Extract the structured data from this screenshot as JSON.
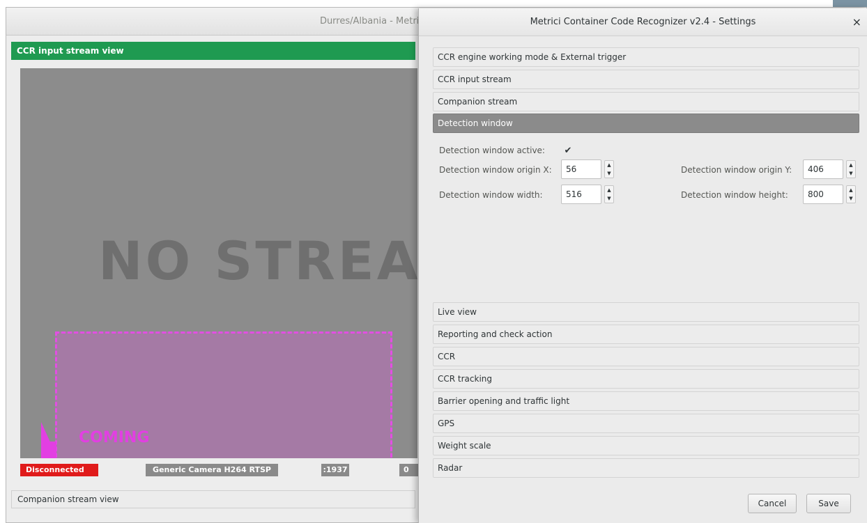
{
  "main_window": {
    "title": "Durres/Albania - Metrici Container Code Recognizer",
    "input_stream_header": "CCR input stream view",
    "no_stream_text": "NO STREAM",
    "coming_label": "COMING",
    "status": {
      "connection": "Disconnected",
      "camera": "Generic Camera H264 RTSP",
      "port": ":1937",
      "extra": "0"
    },
    "companion_header": "Companion stream view"
  },
  "dialog": {
    "title": "Metrici Container Code Recognizer v2.4 - Settings",
    "close_label": "×",
    "sections_top": [
      "CCR engine working mode & External trigger",
      "CCR input stream",
      "Companion stream",
      "Detection window"
    ],
    "active_section": "Detection window",
    "detection": {
      "active_label": "Detection window active:",
      "active_checked": true,
      "check_glyph": "✔",
      "origin_x_label": "Detection window origin X:",
      "origin_x": "56",
      "origin_y_label": "Detection window origin Y:",
      "origin_y": "406",
      "width_label": "Detection window width:",
      "width": "516",
      "height_label": "Detection window height:",
      "height": "800",
      "spin_glyph": "▲\n▼"
    },
    "sections_bottom": [
      "Live view",
      "Reporting and check action",
      "CCR",
      "CCR tracking",
      "Barrier opening and traffic light",
      "GPS",
      "Weight scale",
      "Radar"
    ],
    "buttons": {
      "cancel": "Cancel",
      "save": "Save"
    }
  },
  "colors": {
    "header_green": "#1f9a51",
    "active_section": "#8b8b8b",
    "detection_magenta": "#e34ee3",
    "disconnected_red": "#e01b1b"
  }
}
